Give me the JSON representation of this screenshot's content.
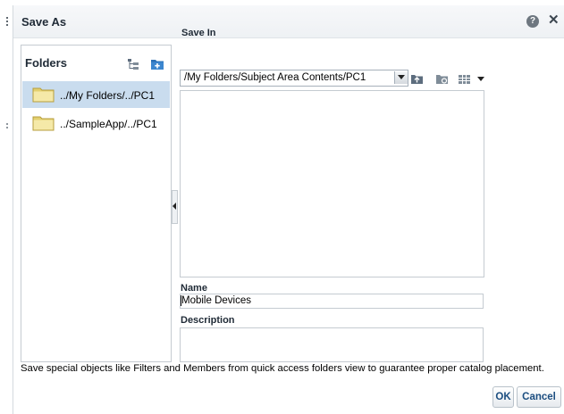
{
  "dialog": {
    "title": "Save As",
    "help_icon": "question-circle-icon",
    "close_icon": "close-icon"
  },
  "folders": {
    "title": "Folders",
    "items": [
      {
        "label": "../My Folders/../PC1",
        "selected": true,
        "icon": "folder-icon"
      },
      {
        "label": "../SampleApp/../PC1",
        "selected": false,
        "icon": "folder-icon"
      }
    ]
  },
  "save_in": {
    "label": "Save In",
    "path": "/My Folders/Subject Area Contents/PC1"
  },
  "name": {
    "label": "Name",
    "value": "Mobile Devices"
  },
  "description": {
    "label": "Description",
    "value": ""
  },
  "hint": "Save special objects like Filters and Members from quick access folders view to guarantee proper catalog placement.",
  "buttons": {
    "ok": "OK",
    "cancel": "Cancel"
  },
  "colors": {
    "selection": "#c9dcee",
    "button_text": "#1c4e80",
    "folder": "#f3e7a0"
  }
}
